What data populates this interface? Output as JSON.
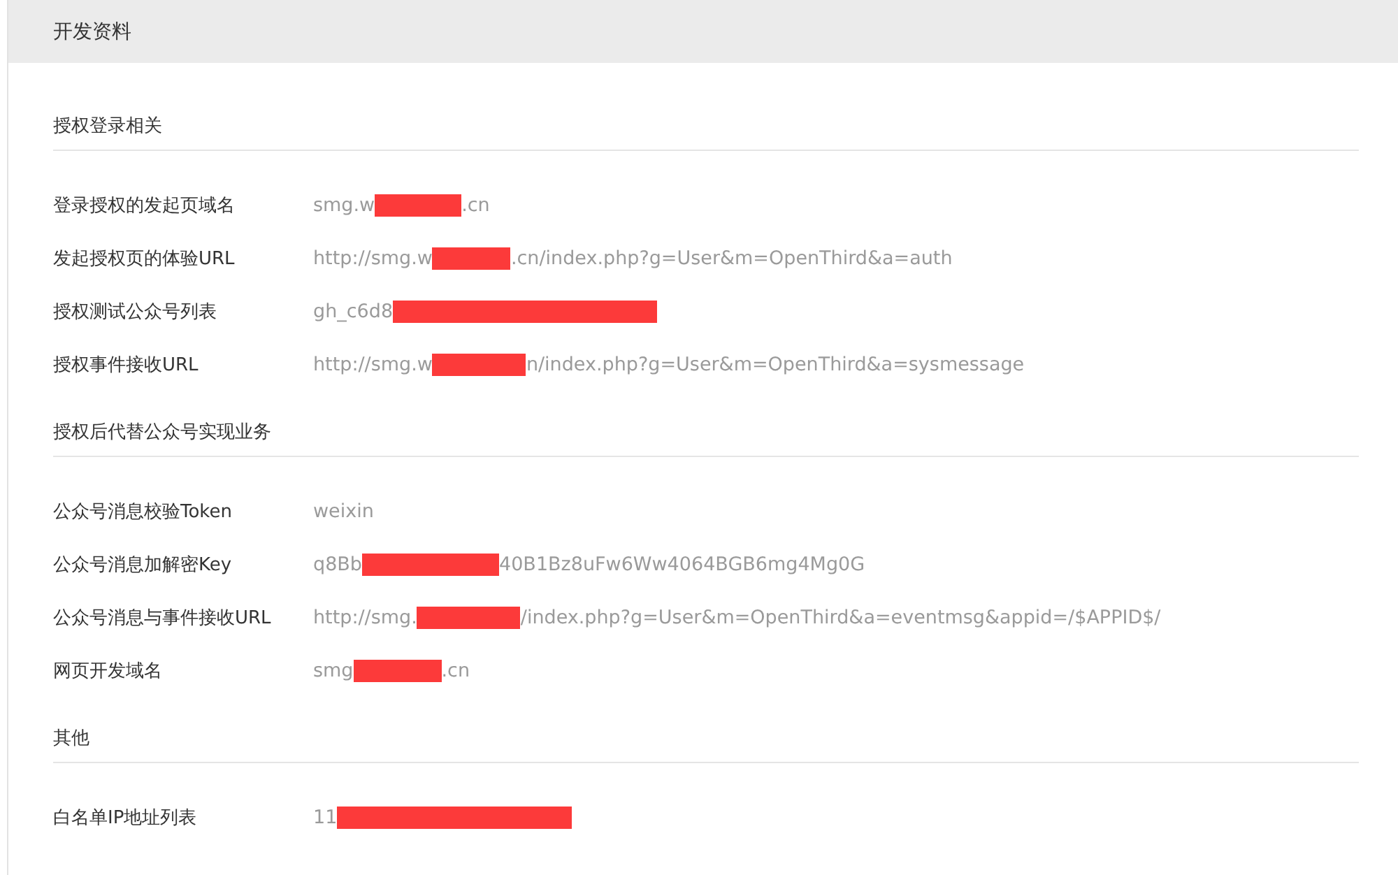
{
  "header": {
    "title": "开发资料"
  },
  "sections": [
    {
      "title": "授权登录相关",
      "rows": [
        {
          "label": "登录授权的发起页域名",
          "before": "smg.w",
          "redacted": true,
          "after": ".cn"
        },
        {
          "label": "发起授权页的体验URL",
          "before": "http://smg.w",
          "redacted": true,
          "after": ".cn/index.php?g=User&m=OpenThird&a=auth"
        },
        {
          "label": "授权测试公众号列表",
          "before": "gh_c6d8",
          "redacted": true
        },
        {
          "label": "授权事件接收URL",
          "before": "http://smg.w",
          "redacted": true,
          "after": "n/index.php?g=User&m=OpenThird&a=sysmessage"
        }
      ]
    },
    {
      "title": "授权后代替公众号实现业务",
      "rows": [
        {
          "label": "公众号消息校验Token",
          "before": "weixin"
        },
        {
          "label": "公众号消息加解密Key",
          "before": "q8Bb",
          "redacted": true,
          "after": "40B1Bz8uFw6Ww4064BGB6mg4Mg0G"
        },
        {
          "label": "公众号消息与事件接收URL",
          "before": "http://smg.",
          "redacted": true,
          "after": "/index.php?g=User&m=OpenThird&a=eventmsg&appid=/$APPID$/"
        },
        {
          "label": "网页开发域名",
          "before": "smg",
          "redacted": true,
          "after": ".cn"
        }
      ]
    },
    {
      "title": "其他",
      "rows": [
        {
          "label": "白名单IP地址列表",
          "before": "11",
          "redacted": true
        }
      ]
    }
  ]
}
